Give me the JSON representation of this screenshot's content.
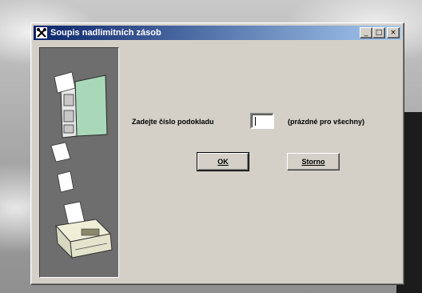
{
  "window": {
    "title": "Soupis nadlimitních zásob",
    "app_icon": "tools-icon",
    "controls": {
      "minimize": "_",
      "maximize": "□",
      "close": "×"
    }
  },
  "illustration": {
    "icons": [
      "file-cabinet-icon",
      "paper-sheet-icon",
      "paper-sheet-icon",
      "printer-icon"
    ]
  },
  "form": {
    "prompt_label": "Zadejte číslo podokladu",
    "input_value": "",
    "hint_label": "(prázdné pro všechny)"
  },
  "buttons": {
    "ok_label": "OK",
    "cancel_label": "Storno"
  },
  "colors": {
    "title_gradient_start": "#0a246a",
    "title_gradient_end": "#a6caf0",
    "dialog_face": "#d4d0c8",
    "side_panel": "#6e6e6e"
  }
}
